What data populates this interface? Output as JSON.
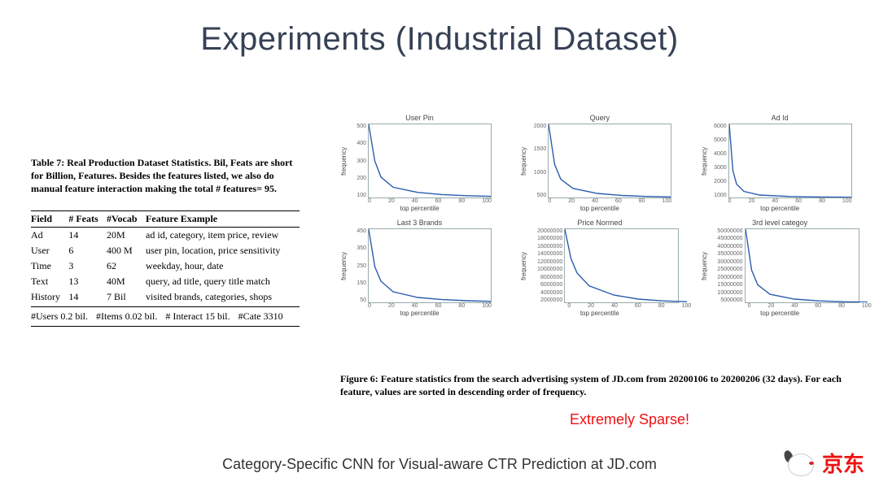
{
  "title": "Experiments (Industrial Dataset)",
  "table7_caption": "Table 7: Real Production Dataset Statistics. Bil, Feats are short for Billion, Features. Besides the features listed, we also do manual feature interaction making the total # features= 95.",
  "table7": {
    "headers": [
      "Field",
      "# Feats",
      "#Vocab",
      "Feature Example"
    ],
    "rows": [
      [
        "Ad",
        "14",
        "20M",
        "ad id, category, item price, review"
      ],
      [
        "User",
        "6",
        "400 M",
        "user pin, location, price sensitivity"
      ],
      [
        "Time",
        "3",
        "62",
        "weekday, hour, date"
      ],
      [
        "Text",
        "13",
        "40M",
        "query, ad title, query title match"
      ],
      [
        "History",
        "14",
        "7 Bil",
        "visited brands, categories, shops"
      ]
    ],
    "footer": [
      "#Users 0.2 bil.",
      "#Items 0.02 bil.",
      "# Interact 15 bil.",
      "#Cate 3310"
    ]
  },
  "chart_data": [
    {
      "type": "line",
      "title": "User Pin",
      "xlabel": "top percentile",
      "ylabel": "frequency",
      "xlim": [
        0,
        100
      ],
      "ylim": [
        0,
        500
      ],
      "x": [
        0,
        5,
        10,
        20,
        40,
        60,
        80,
        100
      ],
      "values": [
        500,
        250,
        140,
        70,
        35,
        20,
        12,
        8
      ],
      "xticks": [
        "0",
        "20",
        "40",
        "60",
        "80",
        "100"
      ],
      "yticks": [
        "500",
        "400",
        "300",
        "200",
        "100"
      ]
    },
    {
      "type": "line",
      "title": "Query",
      "xlabel": "top percentile",
      "ylabel": "frequency",
      "xlim": [
        0,
        100
      ],
      "ylim": [
        0,
        2000
      ],
      "x": [
        0,
        5,
        10,
        20,
        40,
        60,
        80,
        100
      ],
      "values": [
        2000,
        900,
        500,
        250,
        110,
        55,
        30,
        15
      ],
      "xticks": [
        "0",
        "20",
        "40",
        "60",
        "80",
        "100"
      ],
      "yticks": [
        "2000",
        "1500",
        "1000",
        "500"
      ]
    },
    {
      "type": "line",
      "title": "Ad Id",
      "xlabel": "top percentile",
      "ylabel": "frequency",
      "xlim": [
        0,
        100
      ],
      "ylim": [
        0,
        6000
      ],
      "x": [
        0,
        3,
        6,
        12,
        25,
        50,
        75,
        100
      ],
      "values": [
        6000,
        2200,
        1100,
        500,
        200,
        80,
        40,
        20
      ],
      "xticks": [
        "0",
        "20",
        "40",
        "60",
        "80",
        "100"
      ],
      "yticks": [
        "6000",
        "5000",
        "4000",
        "3000",
        "2000",
        "1000"
      ]
    },
    {
      "type": "line",
      "title": "Last 3 Brands",
      "xlabel": "top percentile",
      "ylabel": "frequency",
      "xlim": [
        0,
        100
      ],
      "ylim": [
        0,
        450
      ],
      "x": [
        0,
        5,
        10,
        20,
        40,
        60,
        80,
        100
      ],
      "values": [
        450,
        220,
        130,
        65,
        30,
        17,
        10,
        6
      ],
      "xticks": [
        "0",
        "20",
        "40",
        "60",
        "80",
        "100"
      ],
      "yticks": [
        "450",
        "350",
        "250",
        "150",
        "50"
      ]
    },
    {
      "type": "line",
      "title": "Price Normed",
      "xlabel": "top percentile",
      "ylabel": "frequency",
      "xlim": [
        0,
        100
      ],
      "ylim": [
        0,
        20000000
      ],
      "x": [
        0,
        5,
        10,
        20,
        40,
        60,
        80,
        100
      ],
      "values": [
        20000000,
        12000000,
        8000000,
        4500000,
        2000000,
        900000,
        400000,
        150000
      ],
      "xticks": [
        "0",
        "20",
        "40",
        "60",
        "80",
        "100"
      ],
      "yticks": [
        "20000000",
        "18000000",
        "16000000",
        "14000000",
        "12000000",
        "10000000",
        "8000000",
        "6000000",
        "4000000",
        "2000000"
      ]
    },
    {
      "type": "line",
      "title": "3rd level categoy",
      "xlabel": "top percentile",
      "ylabel": "frequency",
      "xlim": [
        0,
        100
      ],
      "ylim": [
        0,
        50000000
      ],
      "x": [
        0,
        5,
        10,
        20,
        40,
        60,
        80,
        100
      ],
      "values": [
        50000000,
        22000000,
        12000000,
        5500000,
        2200000,
        1000000,
        400000,
        150000
      ],
      "xticks": [
        "0",
        "20",
        "40",
        "60",
        "80",
        "100"
      ],
      "yticks": [
        "50000000",
        "45000000",
        "40000000",
        "35000000",
        "30000000",
        "25000000",
        "20000000",
        "15000000",
        "10000000",
        "5000000"
      ]
    }
  ],
  "figure6_caption": "Figure 6: Feature statistics from the search advertising system of JD.com from 20200106 to 20200206 (32 days). For each feature, values are sorted in descending order of frequency.",
  "sparse_annotation": "Extremely Sparse!",
  "footer_text": "Category-Specific CNN for Visual-aware CTR Prediction at JD.com",
  "logo_text": "京东"
}
